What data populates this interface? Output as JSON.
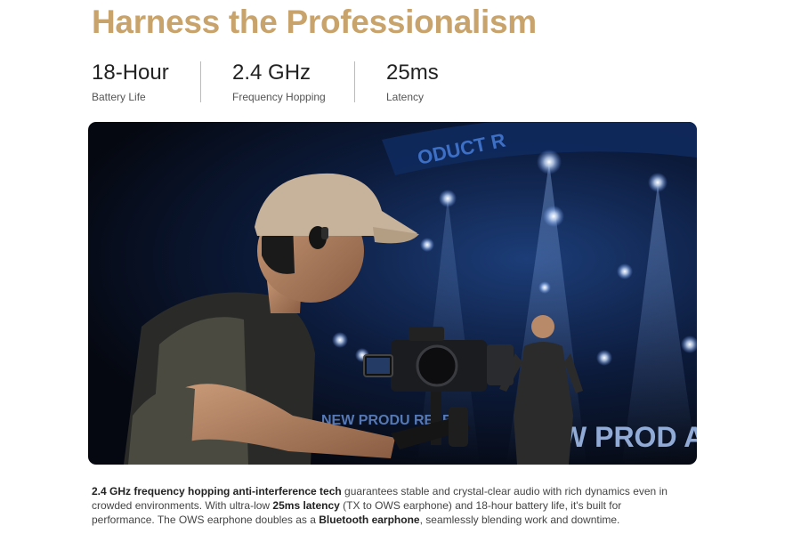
{
  "heading": "Harness the Professionalism",
  "stats": [
    {
      "value": "18-Hour",
      "label": "Battery Life"
    },
    {
      "value": "2.4 GHz",
      "label": "Frequency Hopping"
    },
    {
      "value": "25ms",
      "label": "Latency"
    }
  ],
  "hero": {
    "backdrop_text_top": "ODUCT R",
    "backdrop_text_left": "NEW PRODU RELE",
    "backdrop_text_right": "W PROD ASE M"
  },
  "description": {
    "p1_bold": "2.4 GHz frequency hopping anti-interference tech",
    "p2": " guarantees stable and crystal-clear audio with rich dynamics even in crowded environments. With ultra-low ",
    "p3_bold": "25ms latency",
    "p4": " (TX to OWS earphone) and 18-hour battery life, it's built for performance. The OWS earphone doubles as a ",
    "p5_bold": "Bluetooth earphone",
    "p6": ", seamlessly blending work and downtime."
  },
  "colors": {
    "heading": "#c9a36c",
    "stage_blue": "#1c3d78",
    "text": "#444444"
  }
}
